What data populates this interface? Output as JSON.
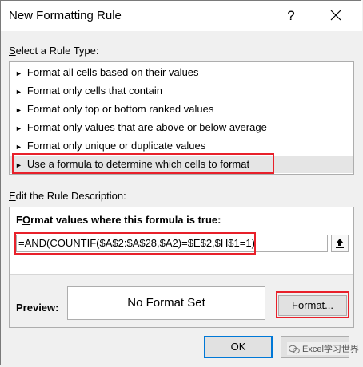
{
  "window": {
    "title": "New Formatting Rule",
    "help_glyph": "?"
  },
  "rule_type": {
    "label_prefix": "",
    "label_underlined": "S",
    "label_rest": "elect a Rule Type:",
    "items": [
      {
        "label": "Format all cells based on their values",
        "selected": false
      },
      {
        "label": "Format only cells that contain",
        "selected": false
      },
      {
        "label": "Format only top or bottom ranked values",
        "selected": false
      },
      {
        "label": "Format only values that are above or below average",
        "selected": false
      },
      {
        "label": "Format only unique or duplicate values",
        "selected": false
      },
      {
        "label": "Use a formula to determine which cells to format",
        "selected": true
      }
    ],
    "arrow_glyph": "►"
  },
  "description": {
    "label_prefix": "",
    "label_underlined": "E",
    "label_rest": "dit the Rule Description:",
    "heading_underlined": "O",
    "heading_prefix": "F",
    "heading_rest": "rmat values where this formula is true:",
    "formula_value": "=AND(COUNTIF($A$2:$A$28,$A2)=$E$2,$H$1=1)",
    "preview_label": "Preview:",
    "preview_text": "No Format Set",
    "format_button_underlined": "F",
    "format_button_rest": "ormat..."
  },
  "buttons": {
    "ok_label": "OK",
    "cancel_label": ""
  },
  "watermark": {
    "text": "Excel学习世界"
  },
  "colors": {
    "highlight_red": "#e8202a",
    "focus_blue": "#0078d7",
    "dialog_bg": "#f0f0f0"
  }
}
